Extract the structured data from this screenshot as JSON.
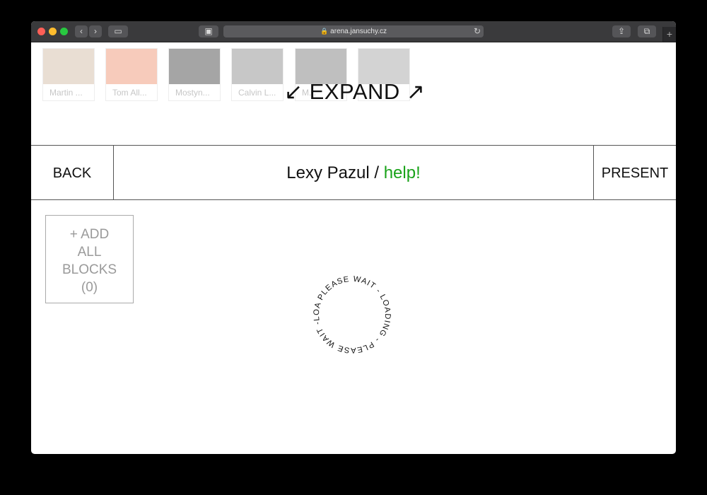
{
  "browser": {
    "url": "arena.jansuchy.cz",
    "lock_glyph": "🔒",
    "reload_glyph": "↻",
    "back_glyph": "‹",
    "forward_glyph": "›",
    "newtab_glyph": "+",
    "share_glyph": "⇪",
    "tabs_glyph": "⧉",
    "sidebar_glyph": "▭",
    "reader_glyph": "▣"
  },
  "thumbnails": [
    {
      "label": "Martin ...",
      "color": "#d7c3b0"
    },
    {
      "label": "Tom All...",
      "color": "#f0a184"
    },
    {
      "label": "Mostyn...",
      "color": "#5c5c5c"
    },
    {
      "label": "Calvin L...",
      "color": "#9a9a9a"
    },
    {
      "label": "M...",
      "color": "#8a8a8a"
    },
    {
      "label": "",
      "color": "#b0b0b0"
    }
  ],
  "expand": {
    "left_arrow": "↙",
    "label": "EXPAND",
    "right_arrow": "↗"
  },
  "header": {
    "back_label": "BACK",
    "title_name": "Lexy Pazul",
    "title_sep": " / ",
    "title_channel": "help!",
    "present_label": "PRESENT"
  },
  "add_all": {
    "line1": "+ ADD",
    "line2": "ALL",
    "line3": "BLOCKS",
    "line4": "(0)"
  },
  "loader": {
    "text": "PLEASE WAIT - LOADING - PLEASE WAIT -LOADING - "
  },
  "colors": {
    "accent_green": "#1aa31a"
  }
}
